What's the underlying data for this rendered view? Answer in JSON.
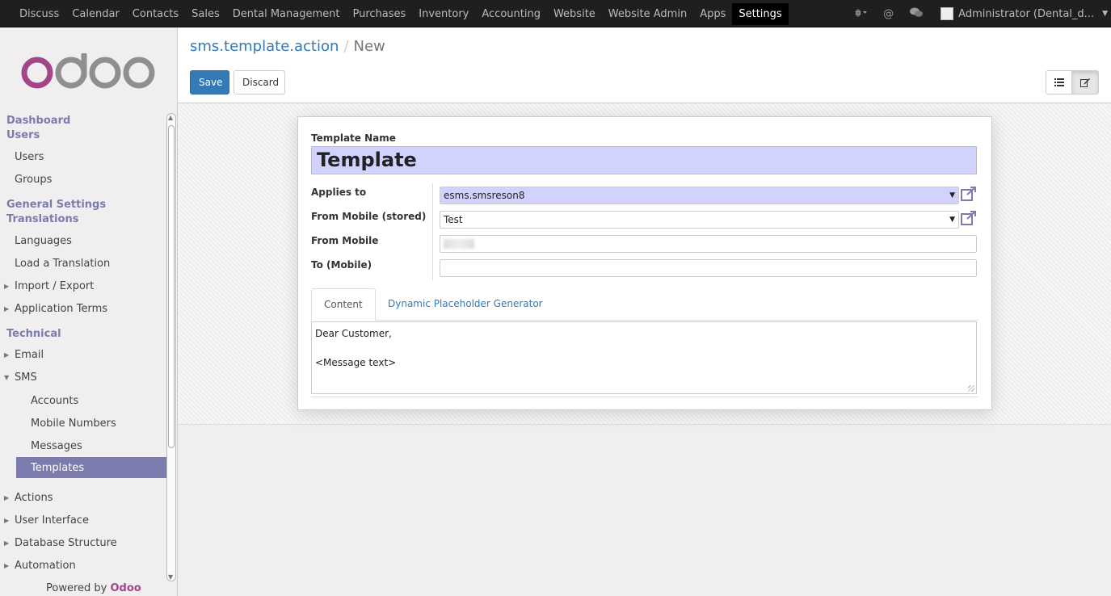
{
  "topbar": {
    "menu": [
      "Discuss",
      "Calendar",
      "Contacts",
      "Sales",
      "Dental Management",
      "Purchases",
      "Inventory",
      "Accounting",
      "Website",
      "Website Admin",
      "Apps",
      "Settings"
    ],
    "active": "Settings",
    "user": "Administrator (Dental_d..."
  },
  "sidebar": {
    "logo_text": "odoo",
    "sections": {
      "dashboard": "Dashboard",
      "users": "Users",
      "general_settings": "General Settings",
      "translations": "Translations",
      "technical": "Technical"
    },
    "items": {
      "users": "Users",
      "groups": "Groups",
      "languages": "Languages",
      "load_translation": "Load a Translation",
      "import_export": "Import / Export",
      "application_terms": "Application Terms",
      "email": "Email",
      "sms": "SMS",
      "accounts": "Accounts",
      "mobile_numbers": "Mobile Numbers",
      "messages": "Messages",
      "templates": "Templates",
      "actions": "Actions",
      "user_interface": "User Interface",
      "database_structure": "Database Structure",
      "automation": "Automation"
    },
    "powered_prefix": "Powered by",
    "powered_brand": "Odoo"
  },
  "control_panel": {
    "breadcrumb_link": "sms.template.action",
    "breadcrumb_sep": "/",
    "breadcrumb_current": "New",
    "save_label": "Save",
    "discard_label": "Discard"
  },
  "form": {
    "template_name_label": "Template Name",
    "template_name_value": "Template",
    "applies_to_label": "Applies to",
    "applies_to_value": "esms.smsreson8",
    "from_mobile_stored_label": "From Mobile (stored)",
    "from_mobile_stored_value": "Test",
    "from_mobile_label": "From Mobile",
    "to_mobile_label": "To (Mobile)",
    "to_mobile_value": "",
    "tab_content": "Content",
    "tab_placeholder": "Dynamic Placeholder Generator",
    "content_lines": [
      "Dear Customer,",
      "",
      "<Message text>"
    ]
  },
  "colors": {
    "navbar": "#1f1f1f",
    "accent": "#7c7bad",
    "required_field": "#d2d2ff",
    "primary_button": "#337ab7"
  }
}
